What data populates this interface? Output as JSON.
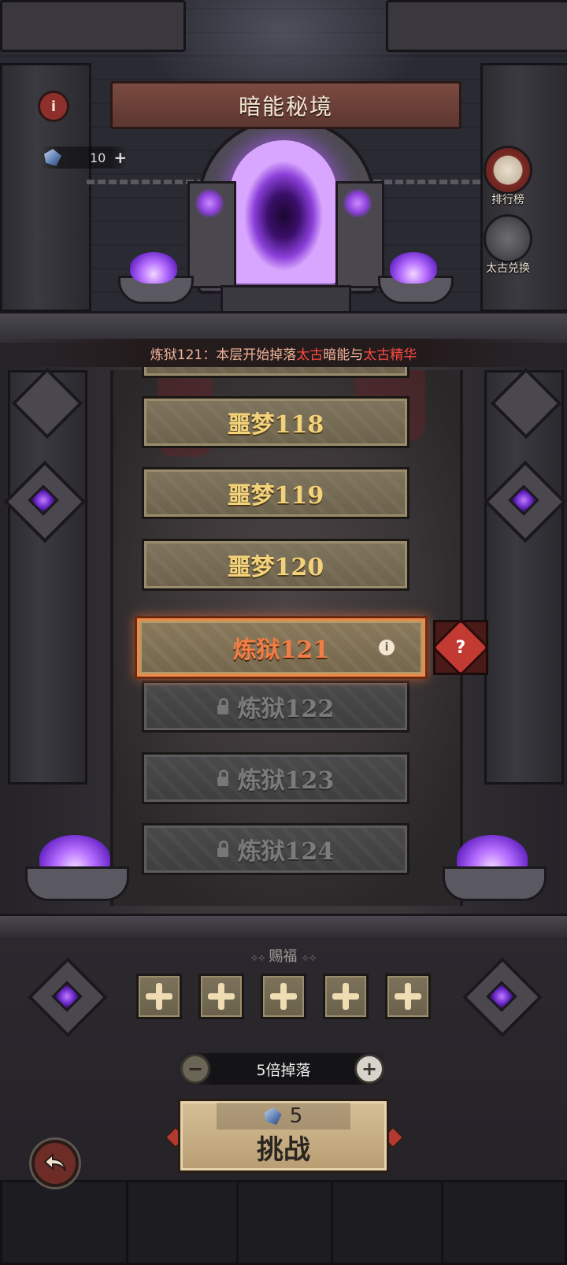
{
  "header": {
    "title": "暗能秘境",
    "info_icon": "info-icon",
    "currency": {
      "icon": "dark-shard-icon",
      "value": "10",
      "add_icon": "plus-icon"
    }
  },
  "side_buttons": [
    {
      "label": "排行榜",
      "icon": "leaderboard-podium-icon"
    },
    {
      "label": "太古兑换",
      "icon": "ancient-exchange-icon"
    }
  ],
  "drop_info": {
    "prefix": "炼狱121：本层开始掉落",
    "highlight1": "太古",
    "mid": "暗能与",
    "highlight2": "太古精华"
  },
  "levels": [
    {
      "label": "噩梦118",
      "state": "cleared"
    },
    {
      "label": "噩梦119",
      "state": "cleared"
    },
    {
      "label": "噩梦120",
      "state": "cleared"
    },
    {
      "label": "炼狱121",
      "state": "current"
    },
    {
      "label": "炼狱122",
      "state": "locked"
    },
    {
      "label": "炼狱123",
      "state": "locked"
    },
    {
      "label": "炼狱124",
      "state": "locked"
    }
  ],
  "mystery_reward": {
    "icon": "question-mark-icon",
    "text": "?"
  },
  "blessing": {
    "label": "赐福",
    "slots": 5,
    "slot_icon": "plus-icon"
  },
  "multiplier": {
    "label": "5倍掉落",
    "minus": "−",
    "plus": "+"
  },
  "challenge": {
    "cost": "5",
    "cost_icon": "dark-shard-icon",
    "label": "挑战"
  },
  "back_button": {
    "icon": "back-arrow-icon"
  },
  "colors": {
    "accent_red": "#ff4a43",
    "current_level_text": "#f27d45",
    "cleared_level_text": "#f3d27a",
    "locked_level_text": "#7b7b7b",
    "portal_purple": "#8a3fd8"
  }
}
